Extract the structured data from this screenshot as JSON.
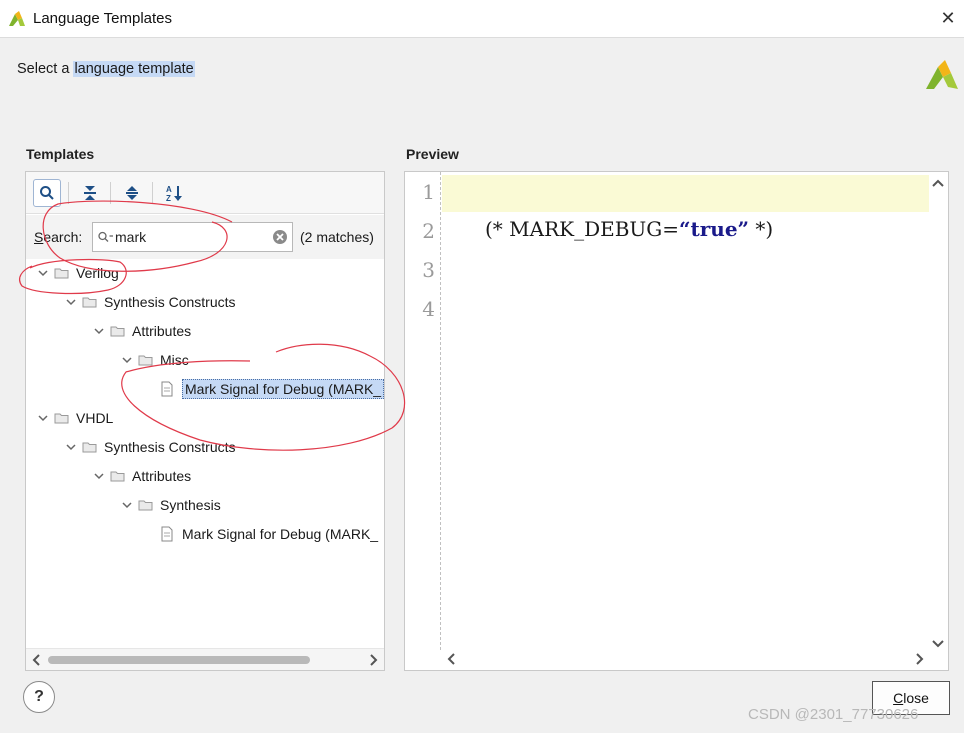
{
  "window": {
    "title": "Language Templates",
    "close_glyph": "✕",
    "logo_icon": "vivado-logo"
  },
  "header": {
    "prefix": "Select a",
    "highlighted": "language template"
  },
  "templates_panel": {
    "label": "Templates",
    "toolbar": [
      {
        "icon": "search-icon",
        "active": true
      },
      {
        "icon": "collapse-all-icon",
        "active": false
      },
      {
        "icon": "expand-all-icon",
        "active": false
      },
      {
        "icon": "sort-az-icon",
        "active": false
      }
    ],
    "search": {
      "label_hotkey": "S",
      "label_rest": "earch:",
      "value": "mark",
      "match_count": "(2 matches)"
    },
    "tree": [
      {
        "label": "Verilog",
        "type": "folder",
        "expanded": true,
        "level": 0
      },
      {
        "label": "Synthesis Constructs",
        "type": "folder",
        "expanded": true,
        "level": 1
      },
      {
        "label": "Attributes",
        "type": "folder",
        "expanded": true,
        "level": 2
      },
      {
        "label": "Misc",
        "type": "folder",
        "expanded": true,
        "level": 3
      },
      {
        "label": "Mark Signal for Debug (MARK_",
        "type": "file",
        "selected": true,
        "level": 4
      },
      {
        "label": "VHDL",
        "type": "folder",
        "expanded": true,
        "level": 0
      },
      {
        "label": "Synthesis Constructs",
        "type": "folder",
        "expanded": true,
        "level": 1
      },
      {
        "label": "Attributes",
        "type": "folder",
        "expanded": true,
        "level": 2
      },
      {
        "label": "Synthesis",
        "type": "folder",
        "expanded": true,
        "level": 3
      },
      {
        "label": "Mark Signal for Debug (MARK_",
        "type": "file",
        "selected": false,
        "level": 4
      }
    ]
  },
  "preview_panel": {
    "label": "Preview",
    "line_numbers": [
      "1",
      "2",
      "3",
      "4"
    ],
    "code": {
      "before": "(* MARK_DEBUG=",
      "string": "“true”",
      "after": " *)"
    }
  },
  "footer": {
    "help_label": "?",
    "close_hotkey": "C",
    "close_rest": "lose"
  },
  "watermark": "CSDN @2301_77730626",
  "colors": {
    "selection": "#c5d9f5",
    "highlight_line": "#fafad5",
    "annotation": "#e03a4a",
    "code_string": "#1a1a8a"
  }
}
